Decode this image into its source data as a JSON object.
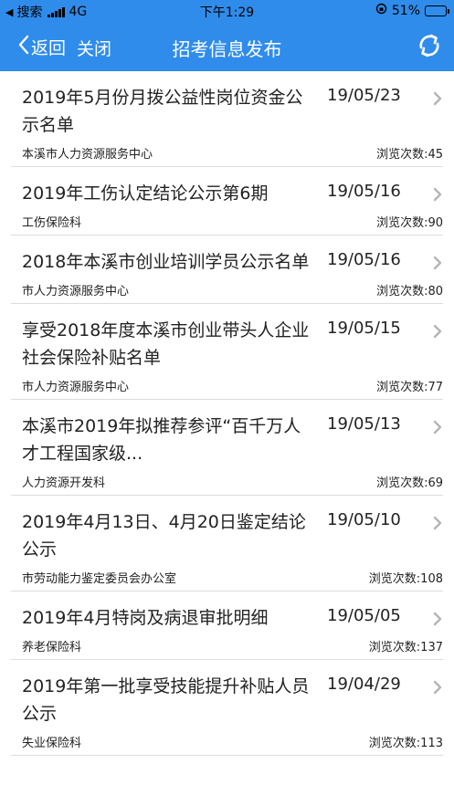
{
  "status_bar": {
    "carrier": "搜索",
    "network": "4G",
    "time": "下午1:29",
    "battery": "51%",
    "battery_level": 0.51
  },
  "nav": {
    "back_label": "返回",
    "close_label": "关闭",
    "title": "招考信息发布"
  },
  "items": [
    {
      "title": "2019年5月份月拨公益性岗位资金公示名单",
      "date": "19/05/23",
      "source": "本溪市人力资源服务中心",
      "views": "浏览次数:45"
    },
    {
      "title": "2019年工伤认定结论公示第6期",
      "date": "19/05/16",
      "source": "工伤保险科",
      "views": "浏览次数:90"
    },
    {
      "title": "2018年本溪市创业培训学员公示名单",
      "date": "19/05/16",
      "source": "市人力资源服务中心",
      "views": "浏览次数:80"
    },
    {
      "title": "享受2018年度本溪市创业带头人企业社会保险补贴名单",
      "date": "19/05/15",
      "source": "市人力资源服务中心",
      "views": "浏览次数:77"
    },
    {
      "title": "本溪市2019年拟推荐参评“百千万人才工程国家级...",
      "date": "19/05/13",
      "source": "人力资源开发科",
      "views": "浏览次数:69"
    },
    {
      "title": "2019年4月13日、4月20日鉴定结论公示",
      "date": "19/05/10",
      "source": "市劳动能力鉴定委员会办公室",
      "views": "浏览次数:108"
    },
    {
      "title": "2019年4月特岗及病退审批明细",
      "date": "19/05/05",
      "source": "养老保险科",
      "views": "浏览次数:137"
    },
    {
      "title": "2019年第一批享受技能提升补贴人员公示",
      "date": "19/04/29",
      "source": "失业保险科",
      "views": "浏览次数:113"
    }
  ]
}
